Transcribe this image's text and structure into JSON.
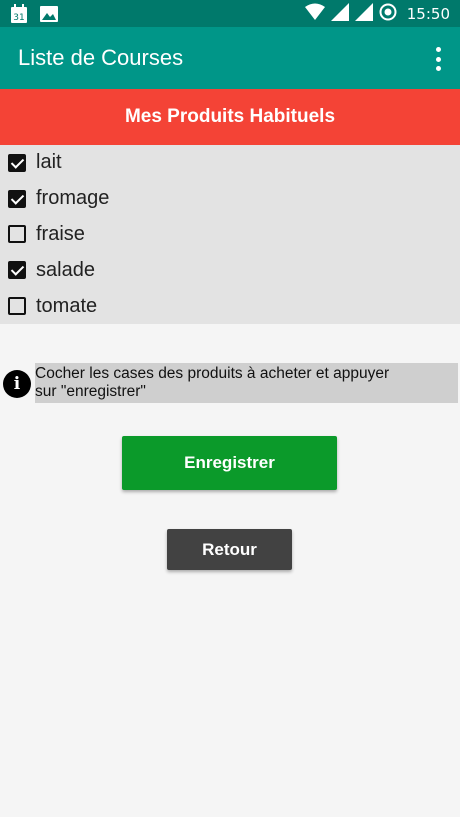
{
  "status_bar": {
    "time": "15:50",
    "calendar_day": "31",
    "icons": [
      "calendar-icon",
      "image-icon",
      "wifi-icon",
      "signal-icon",
      "signal-icon",
      "battery-saver-icon"
    ]
  },
  "app_bar": {
    "title": "Liste de Courses",
    "menu_icon": "overflow-menu-icon"
  },
  "banner": {
    "title": "Mes Produits Habituels"
  },
  "products": [
    {
      "label": "lait",
      "checked": true
    },
    {
      "label": "fromage",
      "checked": true
    },
    {
      "label": "fraise",
      "checked": false
    },
    {
      "label": "salade",
      "checked": true
    },
    {
      "label": "tomate",
      "checked": false
    }
  ],
  "hint": {
    "line1": "Cocher les cases des produits à acheter et appuyer",
    "line2": "sur \"enregistrer\"",
    "icon": "info-icon"
  },
  "buttons": {
    "save_label": "Enregistrer",
    "back_label": "Retour"
  },
  "colors": {
    "status_bar": "#00796b",
    "app_bar": "#009688",
    "banner": "#f44336",
    "save_button": "#0b9a2a",
    "back_button": "#424242"
  }
}
